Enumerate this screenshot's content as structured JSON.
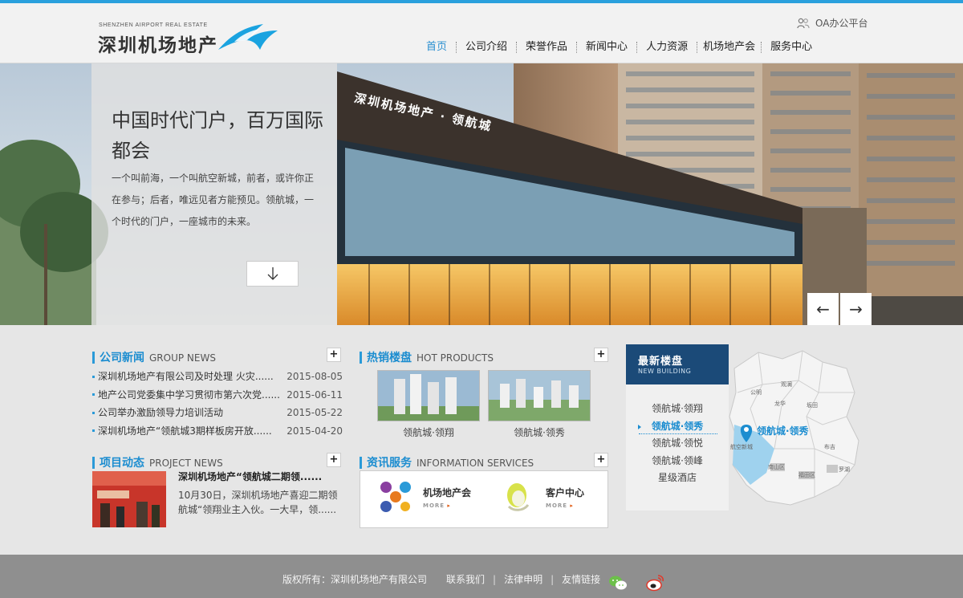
{
  "header": {
    "logo_en": "SHENZHEN AIRPORT REAL ESTATE",
    "logo_cn": "深圳机场地产",
    "oa_label": "OA办公平台",
    "nav": [
      "首页",
      "公司介绍",
      "荣誉作品",
      "新闻中心",
      "人力资源",
      "机场地产会",
      "服务中心"
    ],
    "nav_active": "首页"
  },
  "banner": {
    "title": "中国时代门户，百万国际都会",
    "text": "一个叫前海，一个叫航空新城，前者，或许你正在参与；后者，唯远见者方能预见。领航城，一个时代的门户，一座城市的未来。",
    "building_sign": "深圳机场地产 · 领航城",
    "down_icon": "arrow-down-icon",
    "prev_label": "←",
    "next_label": "→"
  },
  "company_news": {
    "title_cn": "公司新闻",
    "title_en": "GROUP NEWS",
    "items": [
      {
        "title": "深圳机场地产有限公司及时处理 火灾......",
        "date": "2015-08-05"
      },
      {
        "title": "地产公司党委集中学习贯彻市第六次党......",
        "date": "2015-06-11"
      },
      {
        "title": "公司举办激励领导力培训活动",
        "date": "2015-05-22"
      },
      {
        "title": "深圳机场地产“领航城3期样板房开放......",
        "date": "2015-04-20"
      }
    ]
  },
  "project_news": {
    "title_cn": "项目动态",
    "title_en": "PROJECT NEWS",
    "headline": "深圳机场地产“领航城二期领......",
    "desc": "10月30日，深圳机场地产喜迎二期领航城“领翔业主入伙。一大早，领......"
  },
  "hot_products": {
    "title_cn": "热销楼盘",
    "title_en": "HOT PRODUCTS",
    "items": [
      "领航城·领翔",
      "领航城·领秀"
    ]
  },
  "info_services": {
    "title_cn": "资讯服务",
    "title_en": "INFORMATION SERVICES",
    "items": [
      {
        "label": "机场地产会",
        "more": "MORE"
      },
      {
        "label": "客户中心",
        "more": "MORE"
      }
    ]
  },
  "new_building": {
    "title_cn": "最新楼盘",
    "title_en": "NEW BUILDING",
    "items": [
      "领航城·领翔",
      "领航城·领秀",
      "领航城·领悦",
      "领航城·领峰",
      "星级酒店"
    ],
    "active": "领航城·领秀",
    "map_label": "领航城·领秀",
    "map_districts": [
      "公明",
      "观澜",
      "龙华",
      "坂田",
      "布吉",
      "航空新城",
      "南山区",
      "福田区",
      "罗湖"
    ]
  },
  "footer": {
    "copyright": "版权所有：深圳机场地产有限公司",
    "links": [
      "联系我们",
      "法律申明",
      "友情链接"
    ],
    "social": [
      "wechat-icon",
      "weibo-icon"
    ]
  },
  "colors": {
    "accent": "#2aa0dd",
    "nav_active": "#2a8fd0",
    "panel_dark": "#1b4a78",
    "footer": "#8f8f8f"
  }
}
